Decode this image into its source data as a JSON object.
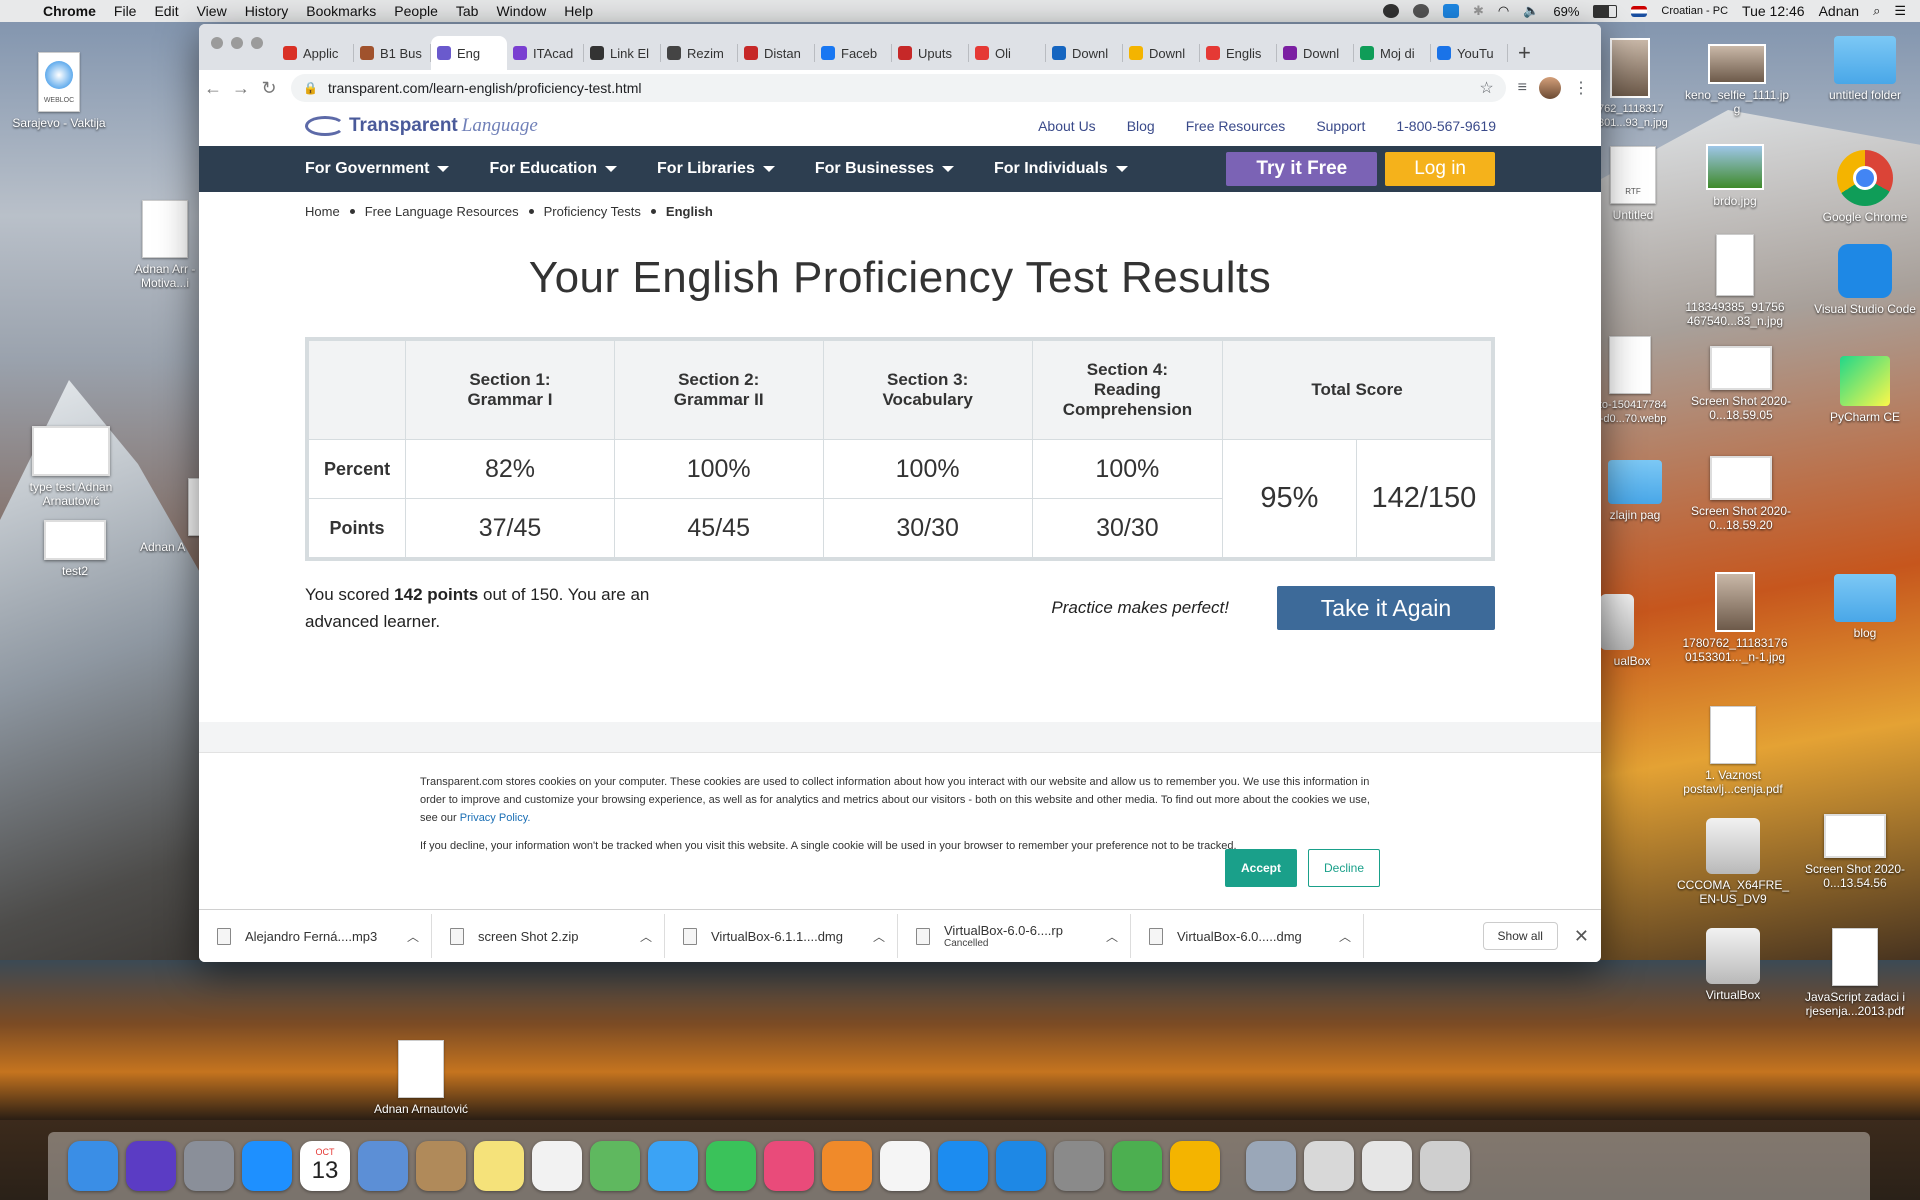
{
  "menubar": {
    "app": "Chrome",
    "items": [
      "File",
      "Edit",
      "View",
      "History",
      "Bookmarks",
      "People",
      "Tab",
      "Window",
      "Help"
    ],
    "battery": "69%",
    "input_source": "Croatian - PC",
    "clock": "Tue 12:46",
    "user": "Adnan"
  },
  "desktop": {
    "icons": [
      {
        "label": "Sarajevo - Vaktija",
        "badge": "WEBLOC"
      },
      {
        "label": "Adnan Arr - Motiva...i"
      },
      {
        "label": "type test Adnan Arnautović"
      },
      {
        "label": "test2"
      },
      {
        "label": "Adnan A"
      },
      {
        "label": "Adnan Arnautović"
      },
      {
        "label": "762_1118317 301...93_n.jpg"
      },
      {
        "label": "keno_selfie_1111.jp g"
      },
      {
        "label": "untitled folder"
      },
      {
        "label": "Untitled",
        "badge": "RTF"
      },
      {
        "label": "brdo.jpg"
      },
      {
        "label": "Google Chrome"
      },
      {
        "label": "118349385_91756 467540...83_n.jpg"
      },
      {
        "label": "Visual Studio Code"
      },
      {
        "label": "sto-150417784 4-d0...70.webp"
      },
      {
        "label": "Screen Shot 2020-0...18.59.05"
      },
      {
        "label": "PyCharm CE"
      },
      {
        "label": "zlajin pag"
      },
      {
        "label": "Screen Shot 2020-0...18.59.20"
      },
      {
        "label": "ualBox"
      },
      {
        "label": "1780762_11183176 0153301..._n-1.jpg"
      },
      {
        "label": "blog"
      },
      {
        "label": "1. Vaznost postavlj...cenja.pdf"
      },
      {
        "label": "CCCOMA_X64FRE_ EN-US_DV9"
      },
      {
        "label": "Screen Shot 2020-0...13.54.56"
      },
      {
        "label": "VirtualBox"
      },
      {
        "label": "JavaScript zadaci i rjesenja...2013.pdf"
      }
    ]
  },
  "browser": {
    "tabs": [
      {
        "label": "Applic",
        "color": "#d93025"
      },
      {
        "label": "B1 Bus",
        "color": "#a0522d"
      },
      {
        "label": "Eng",
        "color": "#6a5acd",
        "active": true
      },
      {
        "label": "ITAcad",
        "color": "#7a3fd1"
      },
      {
        "label": "Link El",
        "color": "#333333"
      },
      {
        "label": "Rezim",
        "color": "#444444"
      },
      {
        "label": "Distan",
        "color": "#c62828"
      },
      {
        "label": "Faceb",
        "color": "#1877f2"
      },
      {
        "label": "Uputs",
        "color": "#c62828"
      },
      {
        "label": "Oli",
        "color": "#e53935"
      },
      {
        "label": "Downl",
        "color": "#1565c0"
      },
      {
        "label": "Downl",
        "color": "#f4b400"
      },
      {
        "label": "Englis",
        "color": "#e53935"
      },
      {
        "label": "Downl",
        "color": "#7b1fa2"
      },
      {
        "label": "Moj di",
        "color": "#0f9d58"
      },
      {
        "label": "YouTu",
        "color": "#1a73e8"
      }
    ],
    "url": "transparent.com/learn-english/proficiency-test.html"
  },
  "site": {
    "logo": {
      "word1": "Transparent",
      "word2": "Language"
    },
    "top_links": [
      "About Us",
      "Blog",
      "Free Resources",
      "Support",
      "1-800-567-9619"
    ],
    "nav": [
      "For Government",
      "For Education",
      "For Libraries",
      "For Businesses",
      "For Individuals"
    ],
    "try_free": "Try it Free",
    "login": "Log in",
    "breadcrumb": [
      "Home",
      "Free Language Resources",
      "Proficiency Tests",
      "English"
    ],
    "title": "Your English Proficiency Test Results",
    "table": {
      "headers": [
        "Section 1: Grammar I",
        "Section 2: Grammar II",
        "Section 3: Vocabulary",
        "Section 4: Reading Comprehension",
        "Total Score"
      ],
      "rows": [
        {
          "label": "Percent",
          "values": [
            "82%",
            "100%",
            "100%",
            "100%"
          ]
        },
        {
          "label": "Points",
          "values": [
            "37/45",
            "45/45",
            "30/30",
            "30/30"
          ]
        }
      ],
      "total_percent": "95%",
      "total_points": "142/150"
    },
    "summary": {
      "pre": "You scored ",
      "points": "142 points",
      "mid": " out of 150. You are an ",
      "level": "advanced learner."
    },
    "practice": "Practice makes perfect!",
    "take_again": "Take it Again",
    "cookie": {
      "text1": "Transparent.com stores cookies on your computer. These cookies are used to collect information about how you interact with our website and allow us to remember you. We use this information in order to improve and customize your browsing experience, as well as for analytics and metrics about our visitors - both on this website and other media. To find out more about the cookies we use, see our ",
      "policy_link": "Privacy Policy.",
      "text2": "If you decline, your information won't be tracked when you visit this website. A single cookie will be used in your browser to remember your preference not to be tracked.",
      "accept": "Accept",
      "decline": "Decline"
    }
  },
  "downloads": {
    "items": [
      {
        "name": "Alejandro Ferná....mp3",
        "sub": ""
      },
      {
        "name": "screen Shot 2.zip",
        "sub": ""
      },
      {
        "name": "VirtualBox-6.1.1....dmg",
        "sub": ""
      },
      {
        "name": "VirtualBox-6.0-6....rp",
        "sub": "Cancelled"
      },
      {
        "name": "VirtualBox-6.0.....dmg",
        "sub": ""
      }
    ],
    "show_all": "Show all"
  },
  "dock": {
    "calendar_month": "OCT",
    "calendar_day": "13",
    "apps": [
      "Finder",
      "Siri",
      "Launchpad",
      "Safari",
      "Calendar",
      "Preview",
      "Contacts",
      "Notes",
      "Reminders",
      "Maps",
      "Messages",
      "FaceTime",
      "iTunes",
      "iBooks",
      "Photos",
      "App Store",
      "Visual Studio Code",
      "System Preferences",
      "uTorrent",
      "Google Chrome",
      "Image Capture",
      "Music Folder",
      "Screen Shots",
      "Trash"
    ]
  },
  "colors": {
    "nav_bg": "#2d3e50",
    "try_free": "#7b63b5",
    "login": "#f5b21b",
    "take_again": "#3d6a99",
    "accept": "#1aa08a"
  }
}
